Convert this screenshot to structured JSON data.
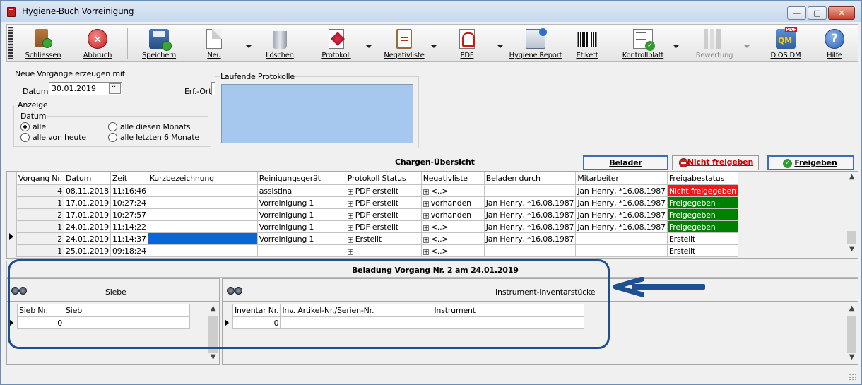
{
  "window": {
    "title": "Hygiene-Buch Vorreinigung",
    "controls": {
      "minimize": "—",
      "maximize": "□",
      "close": "✕"
    }
  },
  "toolbar": {
    "items": [
      {
        "label": "Schliessen",
        "icon": "door-exit-icon"
      },
      {
        "label": "Abbruch",
        "icon": "cancel-icon"
      },
      {
        "label": "Speichern",
        "icon": "save-disk-icon"
      },
      {
        "label": "Neu",
        "icon": "new-document-icon"
      },
      {
        "label": "Löschen",
        "icon": "trash-icon"
      },
      {
        "label": "Protokoll",
        "icon": "protocol-icon"
      },
      {
        "label": "Negativliste",
        "icon": "clipboard-icon"
      },
      {
        "label": "PDF",
        "icon": "pdf-icon"
      },
      {
        "label": "Hygiene Report",
        "icon": "report-icon"
      },
      {
        "label": "Etikett",
        "icon": "barcode-icon"
      },
      {
        "label": "Kontrollblatt",
        "icon": "checklist-icon"
      },
      {
        "label": "Bewertung",
        "icon": "evaluation-icon",
        "disabled": true
      },
      {
        "label": "DIOS DM",
        "icon": "dios-dm-icon"
      },
      {
        "label": "Hilfe",
        "icon": "help-icon"
      }
    ]
  },
  "neue": {
    "title": "Neue Vorgänge erzeugen mit",
    "datum_label": "Datum",
    "datum_value": "30.01.2019",
    "datum_button": "···",
    "erf_label": "Erf.-Ort"
  },
  "anzeige": {
    "title": "Anzeige",
    "datum_group": "Datum",
    "options": [
      {
        "label": "alle",
        "checked": true
      },
      {
        "label": "alle von heute",
        "checked": false
      },
      {
        "label": "alle diesen Monats",
        "checked": false
      },
      {
        "label": "alle letzten 6 Monate",
        "checked": false
      }
    ]
  },
  "laufend": {
    "title": "Laufende Protokolle"
  },
  "chargen": {
    "title": "Chargen-Übersicht",
    "buttons": {
      "belader": "Belader",
      "nicht": "Nicht freigeben",
      "frei": "Freigeben"
    },
    "columns": [
      "Vorgang Nr.",
      "Datum",
      "Zeit",
      "Kurzbezeichnung",
      "Reinigungsgerät",
      "Protokoll Status",
      "Negativliste",
      "Beladen durch",
      "Mitarbeiter",
      "Freigabestatus"
    ],
    "rows": [
      {
        "nr": "4",
        "datum": "08.11.2018",
        "zeit": "11:16:46",
        "kurz": "",
        "geraet": "assistina",
        "protokoll": "PDF erstellt",
        "negativ": "<..>",
        "beladen": "",
        "mitarbeiter": "Jan Henry, *16.08.1987",
        "status": "Nicht freigegeben",
        "status_color": "red"
      },
      {
        "nr": "1",
        "datum": "17.01.2019",
        "zeit": "10:27:24",
        "kurz": "",
        "geraet": "Vorreinigung 1",
        "protokoll": "PDF erstellt",
        "negativ": "vorhanden",
        "beladen": "Jan Henry, *16.08.1987",
        "mitarbeiter": "Jan Henry, *16.08.1987",
        "status": "Freigegeben",
        "status_color": "green"
      },
      {
        "nr": "2",
        "datum": "17.01.2019",
        "zeit": "10:27:57",
        "kurz": "",
        "geraet": "Vorreinigung 1",
        "protokoll": "PDF erstellt",
        "negativ": "vorhanden",
        "beladen": "Jan Henry, *16.08.1987",
        "mitarbeiter": "Jan Henry, *16.08.1987",
        "status": "Freigegeben",
        "status_color": "green"
      },
      {
        "nr": "1",
        "datum": "24.01.2019",
        "zeit": "11:14:22",
        "kurz": "",
        "geraet": "Vorreinigung 1",
        "protokoll": "PDF erstellt",
        "negativ": "<..>",
        "beladen": "Jan Henry, *16.08.1987",
        "mitarbeiter": "Jan Henry, *16.08.1987",
        "status": "Freigegeben",
        "status_color": "green"
      },
      {
        "nr": "2",
        "datum": "24.01.2019",
        "zeit": "11:14:37",
        "kurz": "",
        "geraet": "Vorreinigung 1",
        "protokoll": "Erstellt",
        "negativ": "<..>",
        "beladen": "Jan Henry, *16.08.1987",
        "mitarbeiter": "",
        "status": "Erstellt",
        "status_color": "white",
        "selected": true
      },
      {
        "nr": "1",
        "datum": "25.01.2019",
        "zeit": "09:18:24",
        "kurz": "",
        "geraet": "",
        "protokoll": "",
        "negativ": "<..>",
        "beladen": "",
        "mitarbeiter": "",
        "status": "Erstellt",
        "status_color": "white"
      }
    ]
  },
  "beladung": {
    "title": "Beladung Vorgang Nr. 2 am 24.01.2019",
    "siebe": {
      "title": "Siebe",
      "columns": [
        "Sieb Nr.",
        "Sieb"
      ],
      "row": [
        "0",
        ""
      ]
    },
    "inventar": {
      "title": "Instrument-Inventarstücke",
      "columns": [
        "Inventar Nr.",
        "Inv. Artikel-Nr./Serien-Nr.",
        "Instrument"
      ],
      "row": [
        "0",
        "",
        ""
      ]
    }
  },
  "colors": {
    "highlight": "#1d4f91",
    "status_red": "#f01818",
    "status_green": "#008000",
    "selection": "#0a66d6",
    "list_bg": "#a7c8ee"
  }
}
